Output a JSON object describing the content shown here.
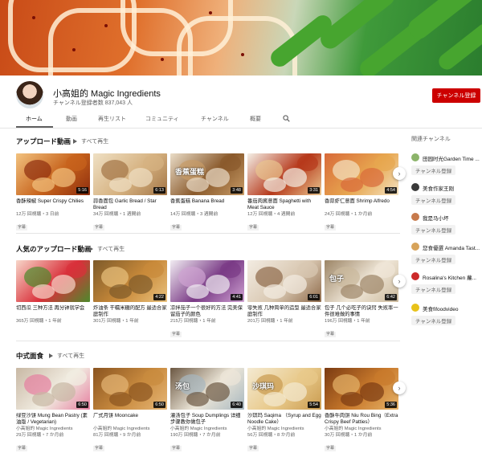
{
  "channel": {
    "name": "小高姐的 Magic Ingredients",
    "subscribers": "チャンネル登録者数 837,043 人",
    "subscribe_label": "チャンネル登録"
  },
  "tabs": [
    {
      "label": "ホーム",
      "active": true
    },
    {
      "label": "動画"
    },
    {
      "label": "再生リスト"
    },
    {
      "label": "コミュニティ"
    },
    {
      "label": "チャンネル"
    },
    {
      "label": "概要"
    }
  ],
  "sections": [
    {
      "title": "アップロード動画",
      "play_all": "すべて再生",
      "videos": [
        {
          "title": "香酥辣椒 Super Crispy Chilies",
          "views": "12万 回視聴・3 日前",
          "duration": "5:16",
          "captions": "字幕",
          "palette": [
            "#c7631c",
            "#8e2d0e",
            "#f2c27f"
          ]
        },
        {
          "title": "蒜香面包 Garlic Bread / Star Bread",
          "views": "34万 回視聴・1 週間前",
          "duration": "6:13",
          "captions": "字幕",
          "palette": [
            "#d6b281",
            "#a27445",
            "#efe0c4"
          ]
        },
        {
          "title": "香蕉蛋糕 Banana Bread",
          "views": "14万 回視聴・3 週間前",
          "duration": "3:48",
          "captions": "字幕",
          "overlay": "香蕉蛋糕",
          "palette": [
            "#8a5a2c",
            "#c79b66",
            "#e9dcc7"
          ]
        },
        {
          "title": "番茄肉酱意面 Spaghetti with Meat Sauce",
          "views": "12万 回視聴・4 週間前",
          "duration": "3:31",
          "captions": "字幕",
          "palette": [
            "#b6391b",
            "#e9c58e",
            "#f4efe6"
          ]
        },
        {
          "title": "香蒜虾仁意面 Shrimp Alfredo",
          "views": "24万 回視聴・1 か月前",
          "duration": "4:54",
          "captions": "字幕",
          "palette": [
            "#e7a64f",
            "#f4e3c2",
            "#d86a3a"
          ]
        }
      ]
    },
    {
      "title": "人気のアップロード動画",
      "play_all": "すべて再生",
      "videos": [
        {
          "title": "切西瓜 三种方法 再分钟就学会",
          "views": "365万 回視聴・1 年前",
          "duration": "",
          "captions": "",
          "palette": [
            "#d9303a",
            "#4d8a2c",
            "#f7d6c9"
          ]
        },
        {
          "title": "炸油条 干糯米糖的配方 最适合家庭制作",
          "views": "301万 回視聴・1 年前",
          "duration": "4:22",
          "captions": "",
          "palette": [
            "#c98a3a",
            "#e9c27e",
            "#7d5a2a"
          ]
        },
        {
          "title": "凉拌茄子一个很好的方法 完美保留茄子的颜色",
          "views": "215万 回視聴・1 年前",
          "duration": "4:41",
          "captions": "字幕",
          "palette": [
            "#7a3b86",
            "#cfa2d2",
            "#f1ecf2"
          ]
        },
        {
          "title": "零失败 几种简单的造型 最适合家庭制作",
          "views": "201万 回視聴・1 年前",
          "duration": "6:01",
          "captions": "",
          "palette": [
            "#d9c8b2",
            "#8e6a4a",
            "#f3ece2"
          ]
        },
        {
          "title": "包子 几个必吃子的诀窍 失败率一件很难做的事情",
          "views": "196万 回視聴・1 年前",
          "duration": "6:42",
          "captions": "字幕",
          "overlay": "包子",
          "palette": [
            "#efe6d7",
            "#cbb99c",
            "#9c8566"
          ]
        }
      ]
    },
    {
      "title": "中式面食",
      "play_all": "すべて再生",
      "videos": [
        {
          "title": "绿豆沙饼 Mung Bean Pastry (素油版 / Vegetarian)",
          "channel": "小高姐的 Magic Ingredients",
          "views": "29万 回視聴・7 か月前",
          "duration": "6:50",
          "captions": "字幕",
          "palette": [
            "#f1ece1",
            "#e67fa0",
            "#c8b8a4"
          ]
        },
        {
          "title": "广式月饼 Mooncake",
          "channel": "小高姐的 Magic Ingredients",
          "views": "81万 回視聴・9 か月前",
          "duration": "6:50",
          "captions": "字幕",
          "palette": [
            "#c98b3f",
            "#e6b676",
            "#8a5420"
          ]
        },
        {
          "title": "灌汤包子 Soup Dumplings 详细步骤教你做包子",
          "channel": "小高姐的 Magic Ingredients",
          "views": "190万 回視聴・7 か月前",
          "duration": "6:40",
          "captions": "字幕",
          "overlay": "汤包",
          "palette": [
            "#ece6d8",
            "#a7b7bf",
            "#6c5843"
          ]
        },
        {
          "title": "沙琪玛 Saqima （Syrup and Egg Noodle Cake）",
          "channel": "小高姐的 Magic Ingredients",
          "views": "56万 回視聴・8 か月前",
          "duration": "5:54",
          "captions": "字幕",
          "overlay": "沙琪玛",
          "palette": [
            "#e8c98a",
            "#c99a4e",
            "#f4ead2"
          ]
        },
        {
          "title": "香酥牛肉饼 Niu Rou Bing（Extra Crispy Beef Patties）",
          "channel": "小高姐的 Magic Ingredients",
          "views": "30万 回視聴・1 か月前",
          "duration": "5:36",
          "captions": "字幕",
          "palette": [
            "#c97a2c",
            "#e6b46a",
            "#7a3a12"
          ]
        }
      ]
    }
  ],
  "related": {
    "title": "関連チャンネル",
    "channels": [
      {
        "name": "田园时光Garden Time ...",
        "subscribe": "チャンネル登録",
        "color": "#8cb46a"
      },
      {
        "name": "美食作家王刚",
        "subscribe": "チャンネル登録",
        "color": "#3a3a3a"
      },
      {
        "name": "我是马小坏",
        "subscribe": "チャンネル登録",
        "color": "#c77a4c"
      },
      {
        "name": "您食優選 Amanda Tast...",
        "subscribe": "チャンネル登録",
        "color": "#d7a35a"
      },
      {
        "name": "Rosalina's Kitchen 蘿...",
        "subscribe": "チャンネル登録",
        "color": "#cc2a2a"
      },
      {
        "name": "美食fifoodvideo",
        "subscribe": "チャンネル登録",
        "color": "#e8c21a"
      }
    ]
  }
}
